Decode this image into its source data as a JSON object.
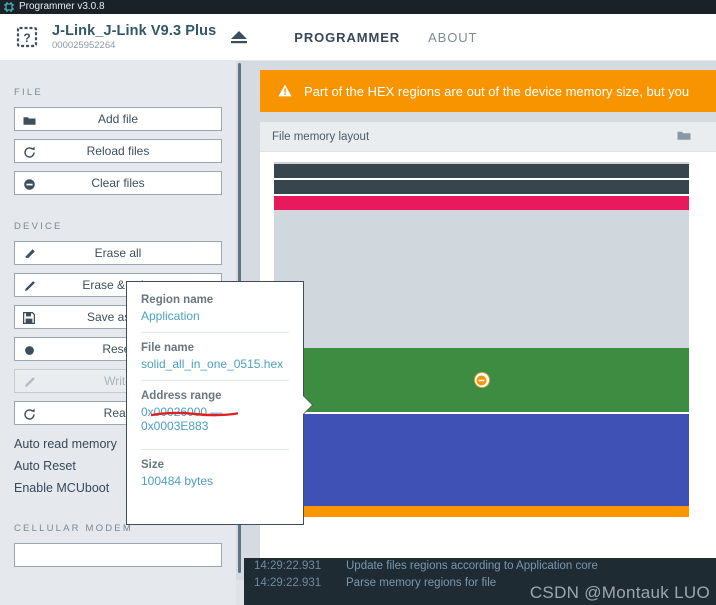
{
  "window": {
    "title": "Programmer v3.0.8",
    "icon": "chip-icon"
  },
  "navbar": {
    "device": {
      "icon": "unknown-chip-icon",
      "name": "J-Link_J-Link V9.3 Plus",
      "serial": "000025952264",
      "eject_icon": "eject-icon"
    },
    "tabs": [
      {
        "label": "PROGRAMMER",
        "active": true
      },
      {
        "label": "ABOUT",
        "active": false
      }
    ]
  },
  "sidebar": {
    "sections": [
      {
        "label": "FILE",
        "buttons": [
          {
            "label": "Add file",
            "icon": "folder-icon",
            "disabled": false
          },
          {
            "label": "Reload files",
            "icon": "reload-icon",
            "disabled": false
          },
          {
            "label": "Clear files",
            "icon": "minus-circle-icon",
            "disabled": false
          }
        ]
      },
      {
        "label": "DEVICE",
        "buttons": [
          {
            "label": "Erase all",
            "icon": "eraser-icon",
            "disabled": false
          },
          {
            "label": "Erase & write",
            "icon": "pencil-icon",
            "disabled": false
          },
          {
            "label": "Save as file",
            "icon": "save-icon",
            "disabled": false
          },
          {
            "label": "Reset",
            "icon": "dot-icon",
            "disabled": false
          },
          {
            "label": "Write",
            "icon": "pencil-icon",
            "disabled": true
          },
          {
            "label": "Read",
            "icon": "reload-icon",
            "disabled": false
          }
        ],
        "toggles": [
          {
            "label": "Auto read memory",
            "on": false
          },
          {
            "label": "Auto Reset",
            "on": false
          },
          {
            "label": "Enable MCUboot",
            "on": true
          }
        ]
      },
      {
        "label": "CELLULAR MODEM",
        "buttons": []
      }
    ]
  },
  "main": {
    "warning": {
      "icon": "warning-triangle-icon",
      "text": "Part of the HEX regions are out of the device memory size, but you"
    },
    "cards": [
      {
        "title": "File memory layout",
        "header_icon": "folder-icon",
        "regions": [
          {
            "name": "region-dark-1",
            "color": "#36454e",
            "height": 14
          },
          {
            "name": "region-gap-1",
            "color": "#ffffff",
            "height": 2
          },
          {
            "name": "region-dark-2",
            "color": "#36454e",
            "height": 14
          },
          {
            "name": "region-gap-2",
            "color": "#ffffff",
            "height": 2
          },
          {
            "name": "region-pink",
            "color": "#e8195c",
            "height": 14
          },
          {
            "name": "region-empty-1",
            "color": "#d0d7dd",
            "height": 138
          },
          {
            "name": "region-green-application",
            "color": "#3e8c41",
            "height": 64,
            "badge": "minus-circle-icon"
          },
          {
            "name": "region-blue",
            "color": "#3f51b5",
            "height": 92
          },
          {
            "name": "region-orange",
            "color": "#fb9500",
            "height": 11
          }
        ]
      },
      {
        "title": "",
        "header_icon": "",
        "regions": []
      }
    ]
  },
  "tooltip": {
    "fields": [
      {
        "key": "Region name",
        "value": "Application",
        "underlined": false
      },
      {
        "key": "File name",
        "value": "solid_all_in_one_0515.hex",
        "underlined": false
      },
      {
        "key": "Address range",
        "value": "0x00026000 — 0x0003E883",
        "underlined": true
      },
      {
        "key": "Size",
        "value": "100484 bytes",
        "underlined": false
      }
    ],
    "annotation_color": "#e02020"
  },
  "log": {
    "lines": [
      {
        "time": "14:29:22.931",
        "text": "Update files regions according to Application core"
      },
      {
        "time": "14:29:22.931",
        "text": "Parse memory regions for file"
      }
    ]
  },
  "watermark": {
    "text": "CSDN @Montauk LUO"
  },
  "colors": {
    "accent_blue": "#4b9fc4",
    "warning_orange": "#f79400",
    "dark_slate": "#36454e",
    "pink": "#e8195c",
    "green": "#3e8c41",
    "blue": "#3f51b5",
    "orange": "#fb9500"
  }
}
